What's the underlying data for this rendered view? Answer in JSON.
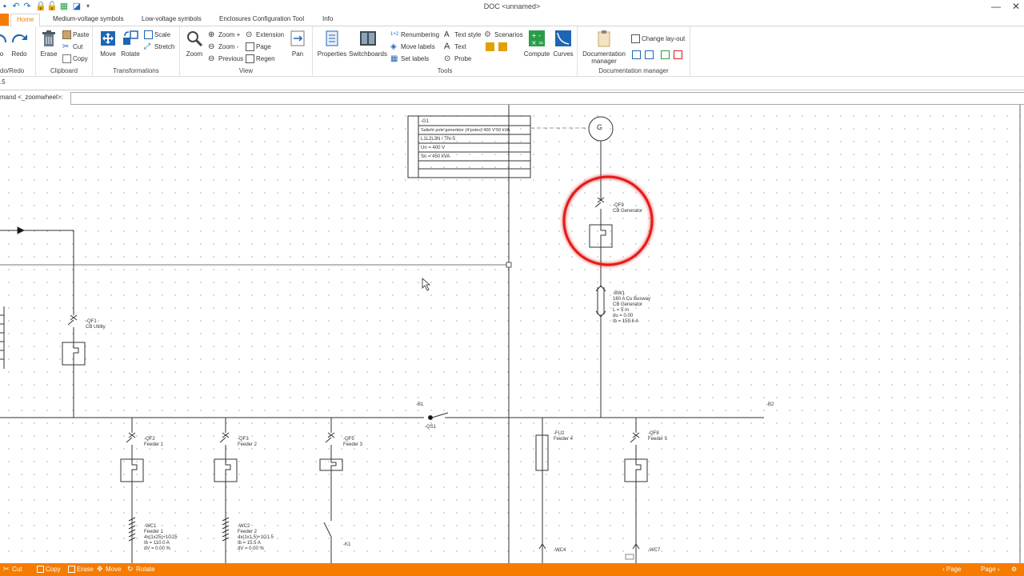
{
  "window": {
    "title": "DOC <unnamed>"
  },
  "tabs": [
    {
      "label": "Home",
      "active": true
    },
    {
      "label": "Medium-voltage symbols"
    },
    {
      "label": "Low-voltage symbols"
    },
    {
      "label": "Enclosures Configuration Tool"
    },
    {
      "label": "Info"
    }
  ],
  "ribbon": {
    "undo_redo": {
      "undo": "o",
      "redo": "Redo",
      "group": "do/Redo"
    },
    "clipboard": {
      "erase": "Erase",
      "paste": "Paste",
      "cut": "Cut",
      "copy": "Copy",
      "group": "Clipboard"
    },
    "transformations": {
      "move": "Move",
      "rotate": "Rotate",
      "scale": "Scale",
      "stretch": "Stretch",
      "group": "Transformations"
    },
    "view": {
      "zoom": "Zoom",
      "zoom_plus": "Zoom +",
      "zoom_minus": "Zoom -",
      "previous": "Previous",
      "extension": "Extension",
      "page": "Page",
      "regen": "Regen",
      "pan": "Pan",
      "group": "View"
    },
    "tools": {
      "properties": "Properties",
      "switchboards": "Switchboards",
      "renumbering": "Renumbering",
      "move_labels": "Move labels",
      "set_labels": "Set labels",
      "text_style": "Text style",
      "text": "Text",
      "probe": "Probe",
      "scenarios": "Scenarios",
      "compute": "Compute",
      "curves": "Curves",
      "group": "Tools"
    },
    "documentation": {
      "manager": "Documentation manager",
      "change_layout": "Change lay-out",
      "group": "Documentation manager"
    }
  },
  "status_line": ".5",
  "command": {
    "label": "mand <_zoomwheel>:",
    "value": ""
  },
  "diagram": {
    "generator_table": [
      "-G1",
      "Salient pole generator (4 poles) 400 V 50 kVA",
      "L1L2L3N / TN-S",
      "Un = 400 V",
      "Sn = 450 kVA",
      ""
    ],
    "generator_symbol": "G",
    "qf9": {
      "name": "-QF9",
      "desc": "CB Generator"
    },
    "bw1": {
      "name": "-BW1",
      "lines": [
        "160 A Cu Busway",
        "CB Generator",
        "L = 5 m",
        "du = 0.00",
        "Ib = 159.6 A"
      ]
    },
    "qf1": {
      "name": "-QF1",
      "desc": "CB Utility"
    },
    "b1": "-B1",
    "b2": "-B2",
    "qs1": "-QS1",
    "feeders": [
      {
        "name": "-QF2",
        "desc": "Feeder 1"
      },
      {
        "name": "-QF3",
        "desc": "Feeder 2"
      },
      {
        "name": "-QF5",
        "desc": "Feeder 3"
      },
      {
        "name": "-FU2",
        "desc": "Feeder 4"
      },
      {
        "name": "-QF8",
        "desc": "Feeder 5"
      }
    ],
    "wc1": {
      "name": "-WC1",
      "lines": [
        "Feeder 1",
        "4x(1x25)+1G25",
        "Ib = 110.0 A",
        "dV = 0.00 %"
      ]
    },
    "wc2": {
      "name": "-WC2",
      "lines": [
        "Feeder 2",
        "4x(1x1.5)+1G1.5",
        "Ib = 15.5 A",
        "dV = 0.00 %"
      ]
    },
    "k1": "-K1",
    "wc4": "-WC4",
    "wc7": "-WC7"
  },
  "statusbar": {
    "left": [
      "Cut",
      "Copy",
      "Erase",
      "Move",
      "Rotate"
    ],
    "prev_page": "Page",
    "next_page": "Page"
  },
  "colors": {
    "accent": "#f57c00",
    "highlight": "#e31b1b"
  }
}
